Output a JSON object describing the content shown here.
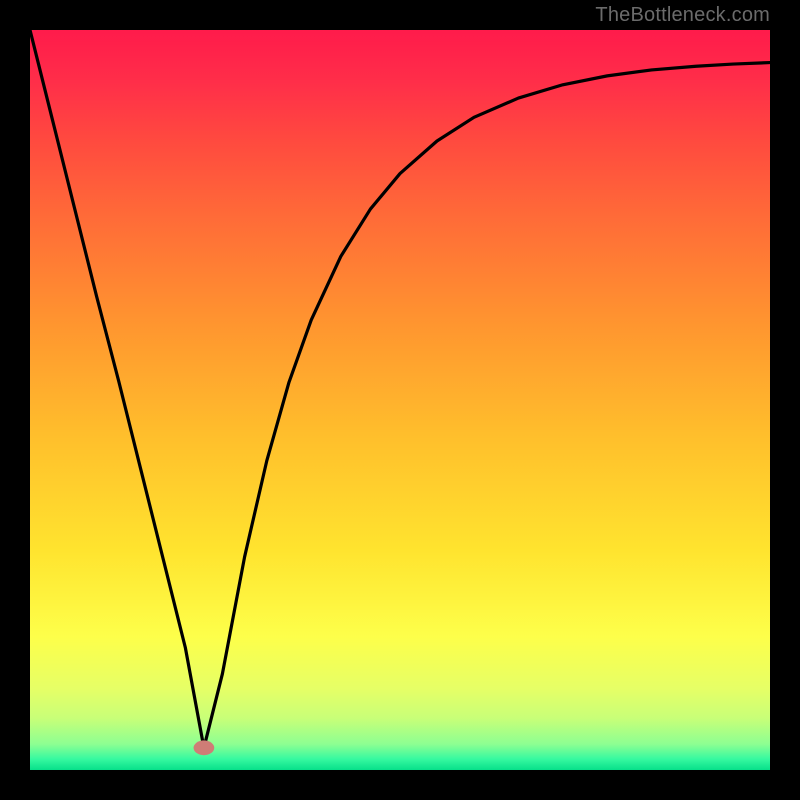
{
  "watermark": "TheBottleneck.com",
  "chart_data": {
    "type": "line",
    "title": "",
    "xlabel": "",
    "ylabel": "",
    "xlim": [
      0,
      100
    ],
    "ylim": [
      0,
      100
    ],
    "background_gradient": {
      "stops": [
        {
          "offset": 0.0,
          "color": "#ff1b4b"
        },
        {
          "offset": 0.07,
          "color": "#ff2e49"
        },
        {
          "offset": 0.15,
          "color": "#ff4a3f"
        },
        {
          "offset": 0.25,
          "color": "#ff6a38"
        },
        {
          "offset": 0.4,
          "color": "#ff962f"
        },
        {
          "offset": 0.55,
          "color": "#ffbf2c"
        },
        {
          "offset": 0.7,
          "color": "#ffe32e"
        },
        {
          "offset": 0.82,
          "color": "#fdff4a"
        },
        {
          "offset": 0.89,
          "color": "#e6ff66"
        },
        {
          "offset": 0.93,
          "color": "#c8ff78"
        },
        {
          "offset": 0.965,
          "color": "#8dff92"
        },
        {
          "offset": 0.985,
          "color": "#37f9a0"
        },
        {
          "offset": 1.0,
          "color": "#07e08a"
        }
      ]
    },
    "series": [
      {
        "name": "bottleneck-curve",
        "x": [
          0,
          3,
          6,
          9,
          12,
          15,
          18,
          21,
          23.5,
          26,
          29,
          32,
          35,
          38,
          42,
          46,
          50,
          55,
          60,
          66,
          72,
          78,
          84,
          90,
          95,
          100
        ],
        "y": [
          100,
          88,
          76,
          64,
          52.5,
          40.5,
          28.5,
          16.5,
          3,
          13,
          28.8,
          41.8,
          52.4,
          60.8,
          69.4,
          75.8,
          80.6,
          85.0,
          88.2,
          90.8,
          92.6,
          93.8,
          94.6,
          95.1,
          95.4,
          95.6
        ]
      }
    ],
    "marker": {
      "x": 23.5,
      "y": 3,
      "rx": 1.4,
      "ry": 1.0,
      "color": "#cf7d76"
    }
  }
}
